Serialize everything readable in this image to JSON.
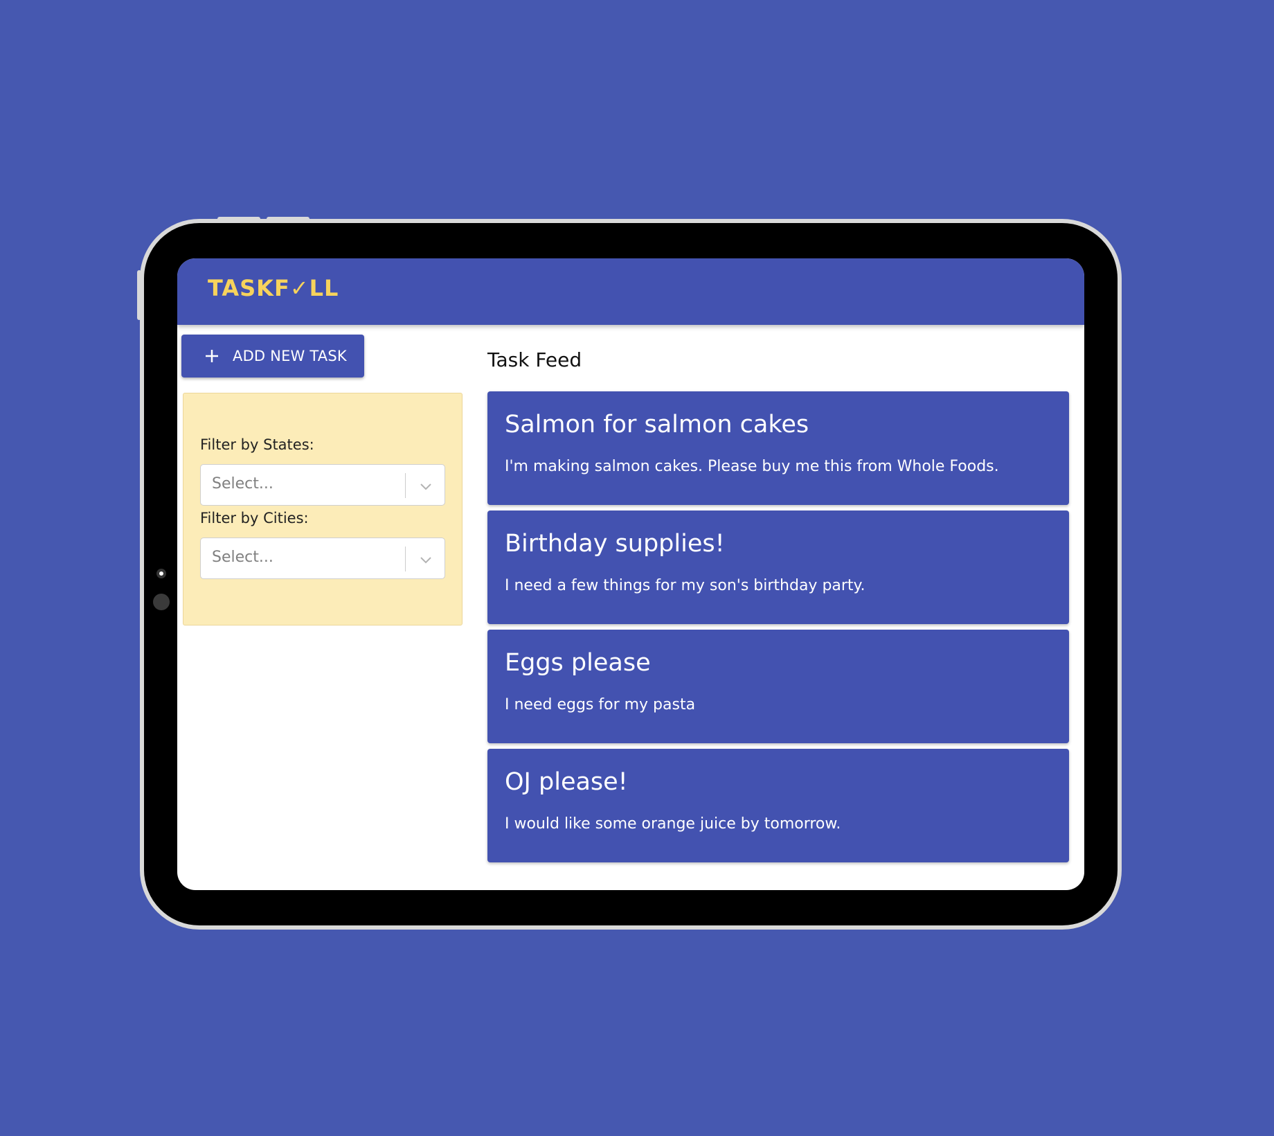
{
  "app": {
    "logo_text": "TASKF✓LL",
    "brand_color": "#4352b0",
    "logo_color": "#f7d35c"
  },
  "toolbar": {
    "add_task_label": "ADD NEW TASK",
    "add_icon": "plus-icon"
  },
  "filters": {
    "states_label": "Filter by States:",
    "states_placeholder": "Select...",
    "cities_label": "Filter by Cities:",
    "cities_placeholder": "Select...",
    "panel_color": "#fcecb8"
  },
  "feed": {
    "title": "Task Feed",
    "tasks": [
      {
        "title": "Salmon for salmon cakes",
        "description": "I'm making salmon cakes. Please buy me this from Whole Foods."
      },
      {
        "title": "Birthday supplies!",
        "description": "I need a few things for my son's birthday party."
      },
      {
        "title": "Eggs please",
        "description": "I need eggs for my pasta"
      },
      {
        "title": "OJ please!",
        "description": "I would like some orange juice by tomorrow."
      }
    ]
  },
  "background_color": "#4658b0"
}
